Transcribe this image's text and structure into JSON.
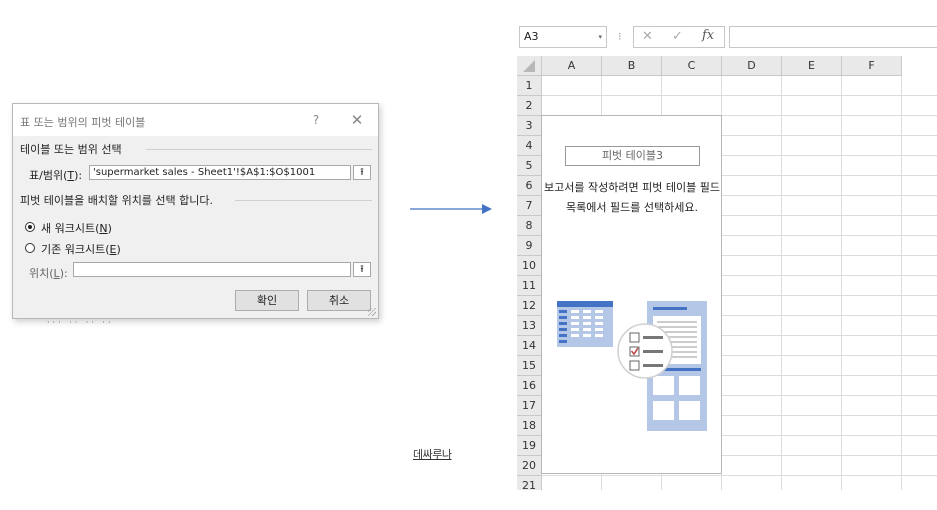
{
  "dialog": {
    "title": "표 또는 범위의 피벗 테이블",
    "help_label": "?",
    "close_label": "✕",
    "section_select_label": "테이블 또는 범위 선택",
    "range_label_prefix": "표/범위(",
    "range_label_key": "T",
    "range_label_suffix": "):",
    "range_value": "'supermarket sales - Sheet1'!$A$1:$O$1001",
    "section_place_label": "피벗 테이블을 배치할 위치를 선택 합니다.",
    "radio_new_prefix": "새 워크시트(",
    "radio_new_key": "N",
    "radio_new_suffix": ")",
    "radio_existing_prefix": "기존 워크시트(",
    "radio_existing_key": "E",
    "radio_existing_suffix": ")",
    "location_label_prefix": "위치(",
    "location_label_key": "L",
    "location_label_suffix": "):",
    "location_value": "",
    "collapse_glyph": "⭱",
    "ok_label": "확인",
    "cancel_label": "취소",
    "selected_option": "new_worksheet"
  },
  "excel": {
    "name_box": "A3",
    "name_box_dropdown": "▾",
    "fx_separator": "⁝",
    "cancel_glyph": "✕",
    "enter_glyph": "✓",
    "fx_label": "fx",
    "formula_value": "",
    "columns": [
      "A",
      "B",
      "C",
      "D",
      "E",
      "F"
    ],
    "rows": [
      "1",
      "2",
      "3",
      "4",
      "5",
      "6",
      "7",
      "8",
      "9",
      "10",
      "11",
      "12",
      "13",
      "14",
      "15",
      "16",
      "17",
      "18",
      "19",
      "20",
      "21"
    ],
    "pivot_name": "피벗 테이블3",
    "pivot_message": "보고서를 작성하려면 피벗 테이블 필드 목록에서 필드를 선택하세요."
  },
  "caption": "데싸루나",
  "colors": {
    "arrow": "#4472c4",
    "illustration_blue": "#4472c4",
    "illustration_light": "#b4c7e7",
    "check_red": "#c0504d"
  }
}
